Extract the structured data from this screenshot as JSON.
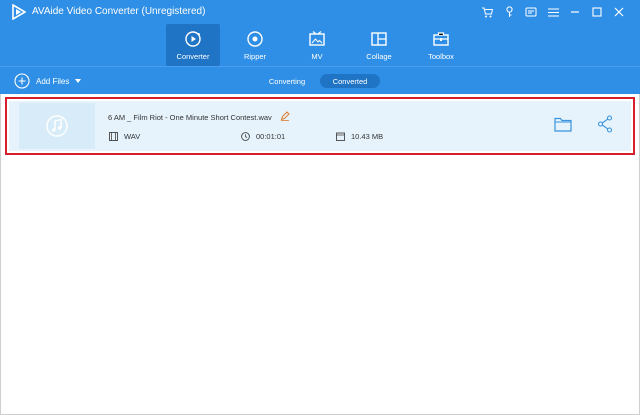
{
  "window": {
    "title": "AVAide Video Converter (Unregistered)",
    "icons": [
      "cart-icon",
      "key-icon",
      "feedback-icon",
      "menu-icon",
      "minimize-icon",
      "maximize-icon",
      "close-icon"
    ]
  },
  "nav": {
    "tabs": [
      {
        "label": "Converter",
        "icon": "converter-icon",
        "active": true
      },
      {
        "label": "Ripper",
        "icon": "ripper-icon",
        "active": false
      },
      {
        "label": "MV",
        "icon": "mv-icon",
        "active": false
      },
      {
        "label": "Collage",
        "icon": "collage-icon",
        "active": false
      },
      {
        "label": "Toolbox",
        "icon": "toolbox-icon",
        "active": false
      }
    ]
  },
  "subbar": {
    "add_files_label": "Add Files",
    "segments": [
      {
        "label": "Converting",
        "active": false
      },
      {
        "label": "Converted",
        "active": true
      }
    ]
  },
  "file": {
    "name": "6 AM _ Film Riot - One Minute Short Contest.wav",
    "format": "WAV",
    "duration": "00:01:01",
    "size": "10.43 MB"
  },
  "colors": {
    "header_blue": "#2f8fe6",
    "active_tab_blue": "#1f74c6",
    "row_background": "#e6f3fc",
    "highlight_red": "#d51f2a"
  }
}
